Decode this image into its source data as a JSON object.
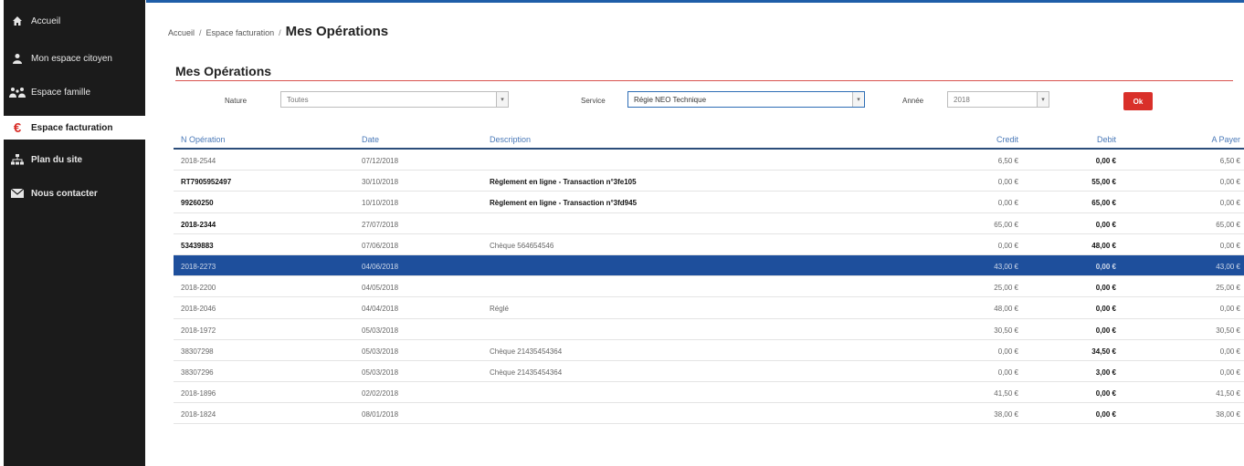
{
  "sidebar": {
    "items": [
      {
        "label": "Accueil",
        "icon": "home-icon"
      },
      {
        "label": "Mon espace citoyen",
        "icon": "user-icon"
      },
      {
        "label": "Espace famille",
        "icon": "family-icon"
      },
      {
        "label": "Espace facturation",
        "icon": "euro-icon"
      },
      {
        "label": "Plan du site",
        "icon": "sitemap-icon"
      },
      {
        "label": "Nous contacter",
        "icon": "envelope-icon"
      }
    ]
  },
  "breadcrumb": {
    "home": "Accueil",
    "parent": "Espace facturation",
    "sep": "/",
    "current": "Mes Opérations"
  },
  "section": {
    "title": "Mes Opérations"
  },
  "filters": {
    "nature_label": "Nature",
    "nature_value": "Toutes",
    "service_label": "Service",
    "service_value": "Régie NEO Technique",
    "annee_label": "Année",
    "annee_value": "2018",
    "ok_label": "Ok"
  },
  "table": {
    "headers": {
      "num": "N Opération",
      "date": "Date",
      "desc": "Description",
      "credit": "Credit",
      "debit": "Debit",
      "pay": "A Payer"
    },
    "rows": [
      {
        "num": "2018-2544",
        "date": "07/12/2018",
        "desc": "",
        "credit": "6,50 €",
        "debit": "0,00 €",
        "pay": "6,50 €"
      },
      {
        "num": "RT7905952497",
        "date": "30/10/2018",
        "desc": "Règlement en ligne - Transaction n°3fe105",
        "credit": "0,00 €",
        "debit": "55,00 €",
        "pay": "0,00 €"
      },
      {
        "num": "99260250",
        "date": "10/10/2018",
        "desc": "Règlement en ligne - Transaction n°3fd945",
        "credit": "0,00 €",
        "debit": "65,00 €",
        "pay": "0,00 €"
      },
      {
        "num": "2018-2344",
        "date": "27/07/2018",
        "desc": "",
        "credit": "65,00 €",
        "debit": "0,00 €",
        "pay": "65,00 €"
      },
      {
        "num": "53439883",
        "date": "07/06/2018",
        "desc": "Chèque 564654546",
        "credit": "0,00 €",
        "debit": "48,00 €",
        "pay": "0,00 €"
      },
      {
        "num": "2018-2273",
        "date": "04/06/2018",
        "desc": "",
        "credit": "43,00 €",
        "debit": "0,00 €",
        "pay": "43,00 €"
      },
      {
        "num": "2018-2200",
        "date": "04/05/2018",
        "desc": "",
        "credit": "25,00 €",
        "debit": "0,00 €",
        "pay": "25,00 €"
      },
      {
        "num": "2018-2046",
        "date": "04/04/2018",
        "desc": "Réglé",
        "credit": "48,00 €",
        "debit": "0,00 €",
        "pay": "0,00 €"
      },
      {
        "num": "2018-1972",
        "date": "05/03/2018",
        "desc": "",
        "credit": "30,50 €",
        "debit": "0,00 €",
        "pay": "30,50 €"
      },
      {
        "num": "38307298",
        "date": "05/03/2018",
        "desc": "Chèque 21435454364",
        "credit": "0,00 €",
        "debit": "34,50 €",
        "pay": "0,00 €"
      },
      {
        "num": "38307296",
        "date": "05/03/2018",
        "desc": "Chèque 21435454364",
        "credit": "0,00 €",
        "debit": "3,00 €",
        "pay": "0,00 €"
      },
      {
        "num": "2018-1896",
        "date": "02/02/2018",
        "desc": "",
        "credit": "41,50 €",
        "debit": "0,00 €",
        "pay": "41,50 €"
      },
      {
        "num": "2018-1824",
        "date": "08/01/2018",
        "desc": "",
        "credit": "38,00 €",
        "debit": "0,00 €",
        "pay": "38,00 €"
      }
    ]
  },
  "colors": {
    "sidebar_bg": "#1b1b1b",
    "accent_red": "#d9302a",
    "selected_row": "#1e4f9c",
    "header_blue": "#4a79b8"
  }
}
